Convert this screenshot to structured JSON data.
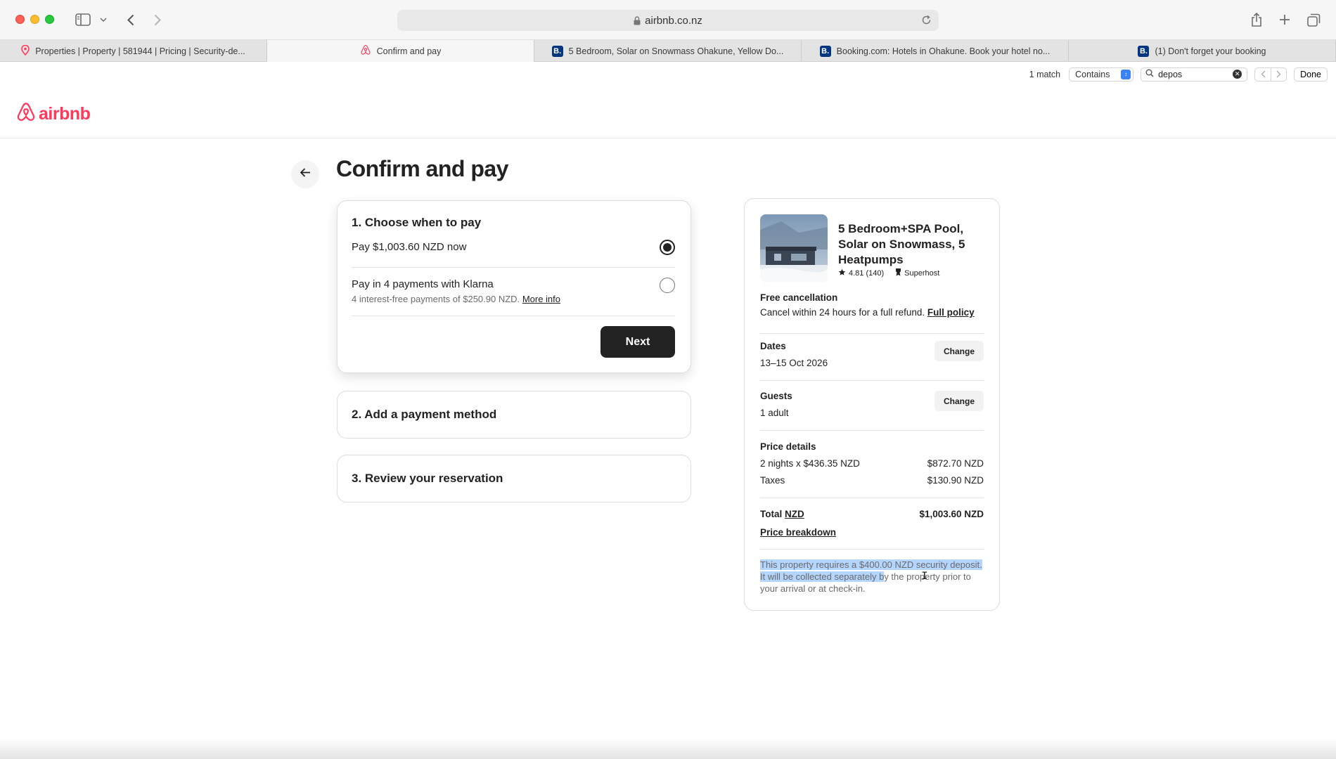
{
  "browser": {
    "url": "airbnb.co.nz",
    "tabs": [
      {
        "title": "Properties | Property | 581944 | Pricing | Security-de...",
        "favicon": "pin-icon",
        "active": false
      },
      {
        "title": "Confirm and pay",
        "favicon": "airbnb-icon",
        "active": true
      },
      {
        "title": "5 Bedroom, Solar on Snowmass Ohakune, Yellow Do...",
        "favicon": "booking-icon",
        "active": false
      },
      {
        "title": "Booking.com: Hotels in Ohakune. Book your hotel no...",
        "favicon": "booking-icon",
        "active": false
      },
      {
        "title": "(1) Don't forget your booking",
        "favicon": "booking-icon",
        "active": false
      }
    ],
    "favicon_letter": "B."
  },
  "find_bar": {
    "match_count": "1 match",
    "mode": "Contains",
    "query": "depos",
    "done_label": "Done"
  },
  "site": {
    "logo_text": "airbnb",
    "brand_color": "#ff385c"
  },
  "page": {
    "title": "Confirm and pay"
  },
  "step1": {
    "heading": "1. Choose when to pay",
    "option_full": "Pay $1,003.60 NZD now",
    "option_klarna": "Pay in 4 payments with Klarna",
    "option_klarna_sub": "4 interest-free payments of $250.90 NZD.",
    "more_info": "More info",
    "next_label": "Next"
  },
  "step2": {
    "heading": "2. Add a payment method"
  },
  "step3": {
    "heading": "3. Review your reservation"
  },
  "summary": {
    "listing_title": "5 Bedroom+SPA Pool, Solar on Snowmass, 5 Heatpumps",
    "rating": "4.81 (140)",
    "host_badge": "Superhost",
    "cancel_heading": "Free cancellation",
    "cancel_text": "Cancel within 24 hours for a full refund.",
    "full_policy": "Full policy",
    "dates_label": "Dates",
    "dates_value": "13–15 Oct 2026",
    "guests_label": "Guests",
    "guests_value": "1 adult",
    "change_label": "Change",
    "price_details_label": "Price details",
    "line_nights": "2 nights x $436.35 NZD",
    "line_nights_amount": "$872.70 NZD",
    "line_taxes": "Taxes",
    "line_taxes_amount": "$130.90 NZD",
    "total_label": "Total",
    "total_currency": "NZD",
    "total_amount": "$1,003.60 NZD",
    "price_breakdown": "Price breakdown",
    "deposit_highlighted": "This property requires a $400.00 NZD security deposit. It will be collected separately b",
    "deposit_rest": "y the property prior to your arrival or at check-in."
  }
}
